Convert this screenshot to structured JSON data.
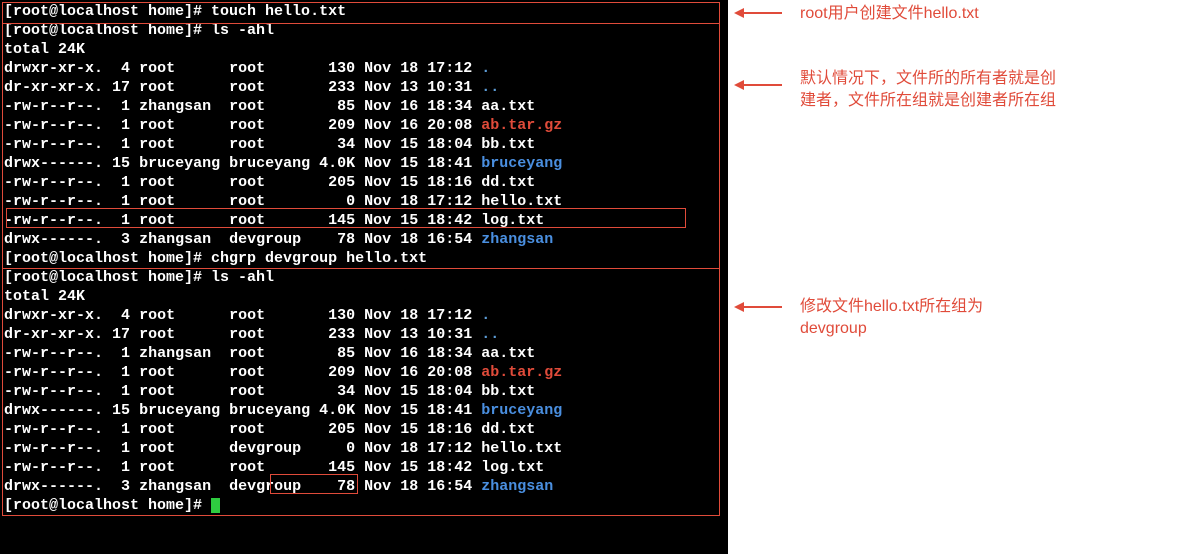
{
  "prompt1": {
    "user": "root",
    "host": "localhost",
    "dir": "home",
    "cmd": "touch hello.txt"
  },
  "prompt2": {
    "user": "root",
    "host": "localhost",
    "dir": "home",
    "cmd": "ls -ahl"
  },
  "total1": "total 24K",
  "listing1": [
    {
      "perm": "drwxr-xr-x.",
      "lnk": "4",
      "own": "root",
      "grp": "root",
      "sz": "130",
      "mon": "Nov",
      "day": "18",
      "tm": "17:12",
      "name": ".",
      "cls": "dot"
    },
    {
      "perm": "dr-xr-xr-x.",
      "lnk": "17",
      "own": "root",
      "grp": "root",
      "sz": "233",
      "mon": "Nov",
      "day": "13",
      "tm": "10:31",
      "name": "..",
      "cls": "dot"
    },
    {
      "perm": "-rw-r--r--.",
      "lnk": "1",
      "own": "zhangsan",
      "grp": "root",
      "sz": "85",
      "mon": "Nov",
      "day": "16",
      "tm": "18:34",
      "name": "aa.txt",
      "cls": "fname-plain"
    },
    {
      "perm": "-rw-r--r--.",
      "lnk": "1",
      "own": "root",
      "grp": "root",
      "sz": "209",
      "mon": "Nov",
      "day": "16",
      "tm": "20:08",
      "name": "ab.tar.gz",
      "cls": "fname-red"
    },
    {
      "perm": "-rw-r--r--.",
      "lnk": "1",
      "own": "root",
      "grp": "root",
      "sz": "34",
      "mon": "Nov",
      "day": "15",
      "tm": "18:04",
      "name": "bb.txt",
      "cls": "fname-plain"
    },
    {
      "perm": "drwx------.",
      "lnk": "15",
      "own": "bruceyang",
      "grp": "bruceyang",
      "sz": "4.0K",
      "mon": "Nov",
      "day": "15",
      "tm": "18:41",
      "name": "bruceyang",
      "cls": "fname-blue"
    },
    {
      "perm": "-rw-r--r--.",
      "lnk": "1",
      "own": "root",
      "grp": "root",
      "sz": "205",
      "mon": "Nov",
      "day": "15",
      "tm": "18:16",
      "name": "dd.txt",
      "cls": "fname-plain"
    },
    {
      "perm": "-rw-r--r--.",
      "lnk": "1",
      "own": "root",
      "grp": "root",
      "sz": "0",
      "mon": "Nov",
      "day": "18",
      "tm": "17:12",
      "name": "hello.txt",
      "cls": "fname-plain"
    },
    {
      "perm": "-rw-r--r--.",
      "lnk": "1",
      "own": "root",
      "grp": "root",
      "sz": "145",
      "mon": "Nov",
      "day": "15",
      "tm": "18:42",
      "name": "log.txt",
      "cls": "fname-plain"
    },
    {
      "perm": "drwx------.",
      "lnk": "3",
      "own": "zhangsan",
      "grp": "devgroup",
      "sz": "78",
      "mon": "Nov",
      "day": "18",
      "tm": "16:54",
      "name": "zhangsan",
      "cls": "fname-blue"
    }
  ],
  "prompt3": {
    "user": "root",
    "host": "localhost",
    "dir": "home",
    "cmd": "chgrp devgroup hello.txt"
  },
  "prompt4": {
    "user": "root",
    "host": "localhost",
    "dir": "home",
    "cmd": "ls -ahl"
  },
  "total2": "total 24K",
  "listing2": [
    {
      "perm": "drwxr-xr-x.",
      "lnk": "4",
      "own": "root",
      "grp": "root",
      "sz": "130",
      "mon": "Nov",
      "day": "18",
      "tm": "17:12",
      "name": ".",
      "cls": "dot"
    },
    {
      "perm": "dr-xr-xr-x.",
      "lnk": "17",
      "own": "root",
      "grp": "root",
      "sz": "233",
      "mon": "Nov",
      "day": "13",
      "tm": "10:31",
      "name": "..",
      "cls": "dot"
    },
    {
      "perm": "-rw-r--r--.",
      "lnk": "1",
      "own": "zhangsan",
      "grp": "root",
      "sz": "85",
      "mon": "Nov",
      "day": "16",
      "tm": "18:34",
      "name": "aa.txt",
      "cls": "fname-plain"
    },
    {
      "perm": "-rw-r--r--.",
      "lnk": "1",
      "own": "root",
      "grp": "root",
      "sz": "209",
      "mon": "Nov",
      "day": "16",
      "tm": "20:08",
      "name": "ab.tar.gz",
      "cls": "fname-red"
    },
    {
      "perm": "-rw-r--r--.",
      "lnk": "1",
      "own": "root",
      "grp": "root",
      "sz": "34",
      "mon": "Nov",
      "day": "15",
      "tm": "18:04",
      "name": "bb.txt",
      "cls": "fname-plain"
    },
    {
      "perm": "drwx------.",
      "lnk": "15",
      "own": "bruceyang",
      "grp": "bruceyang",
      "sz": "4.0K",
      "mon": "Nov",
      "day": "15",
      "tm": "18:41",
      "name": "bruceyang",
      "cls": "fname-blue"
    },
    {
      "perm": "-rw-r--r--.",
      "lnk": "1",
      "own": "root",
      "grp": "root",
      "sz": "205",
      "mon": "Nov",
      "day": "15",
      "tm": "18:16",
      "name": "dd.txt",
      "cls": "fname-plain"
    },
    {
      "perm": "-rw-r--r--.",
      "lnk": "1",
      "own": "root",
      "grp": "devgroup",
      "sz": "0",
      "mon": "Nov",
      "day": "18",
      "tm": "17:12",
      "name": "hello.txt",
      "cls": "fname-plain"
    },
    {
      "perm": "-rw-r--r--.",
      "lnk": "1",
      "own": "root",
      "grp": "root",
      "sz": "145",
      "mon": "Nov",
      "day": "15",
      "tm": "18:42",
      "name": "log.txt",
      "cls": "fname-plain"
    },
    {
      "perm": "drwx------.",
      "lnk": "3",
      "own": "zhangsan",
      "grp": "devgroup",
      "sz": "78",
      "mon": "Nov",
      "day": "18",
      "tm": "16:54",
      "name": "zhangsan",
      "cls": "fname-blue"
    }
  ],
  "prompt5": {
    "user": "root",
    "host": "localhost",
    "dir": "home",
    "cmd": ""
  },
  "annotations": {
    "a1": "root用户创建文件hello.txt",
    "a2": "默认情况下，文件所的所有者就是创\n建者，文件所在组就是创建者所在组",
    "a3": "修改文件hello.txt所在组为\ndevgroup"
  }
}
